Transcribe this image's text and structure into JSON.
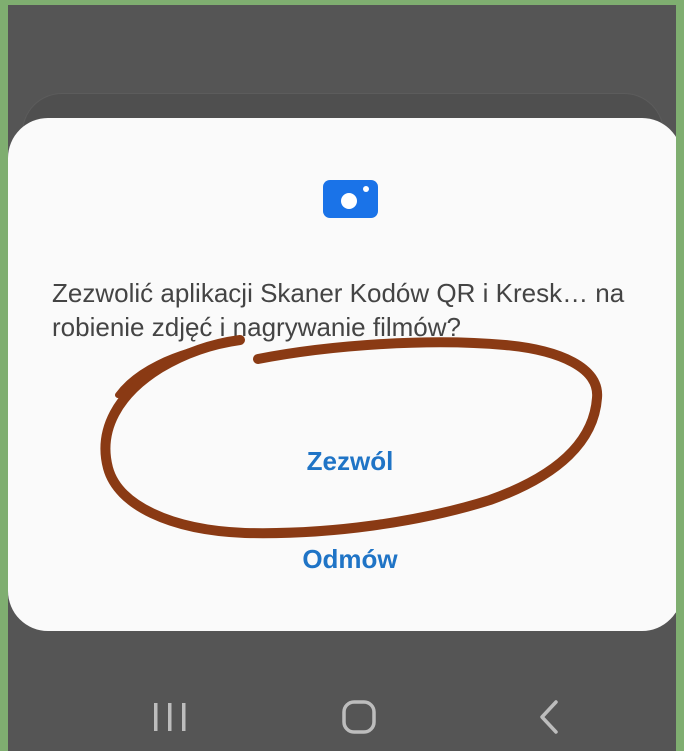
{
  "dialog": {
    "message": "Zezwolić aplikacji Skaner Kodów QR i Kresk… na robienie zdjęć i nagrywanie filmów?",
    "allow_label": "Zezwól",
    "deny_label": "Odmów"
  },
  "icons": {
    "dialog_icon": "camera-icon",
    "navbar": [
      "recent-apps-icon",
      "home-icon",
      "back-icon"
    ]
  },
  "colors": {
    "frame_green": "#7fae70",
    "screen_gray": "#555555",
    "dialog_bg": "#fafafa",
    "accent_blue": "#1f74c6",
    "camera_blue": "#1a73e8",
    "scribble_brown": "#8a3a14"
  }
}
